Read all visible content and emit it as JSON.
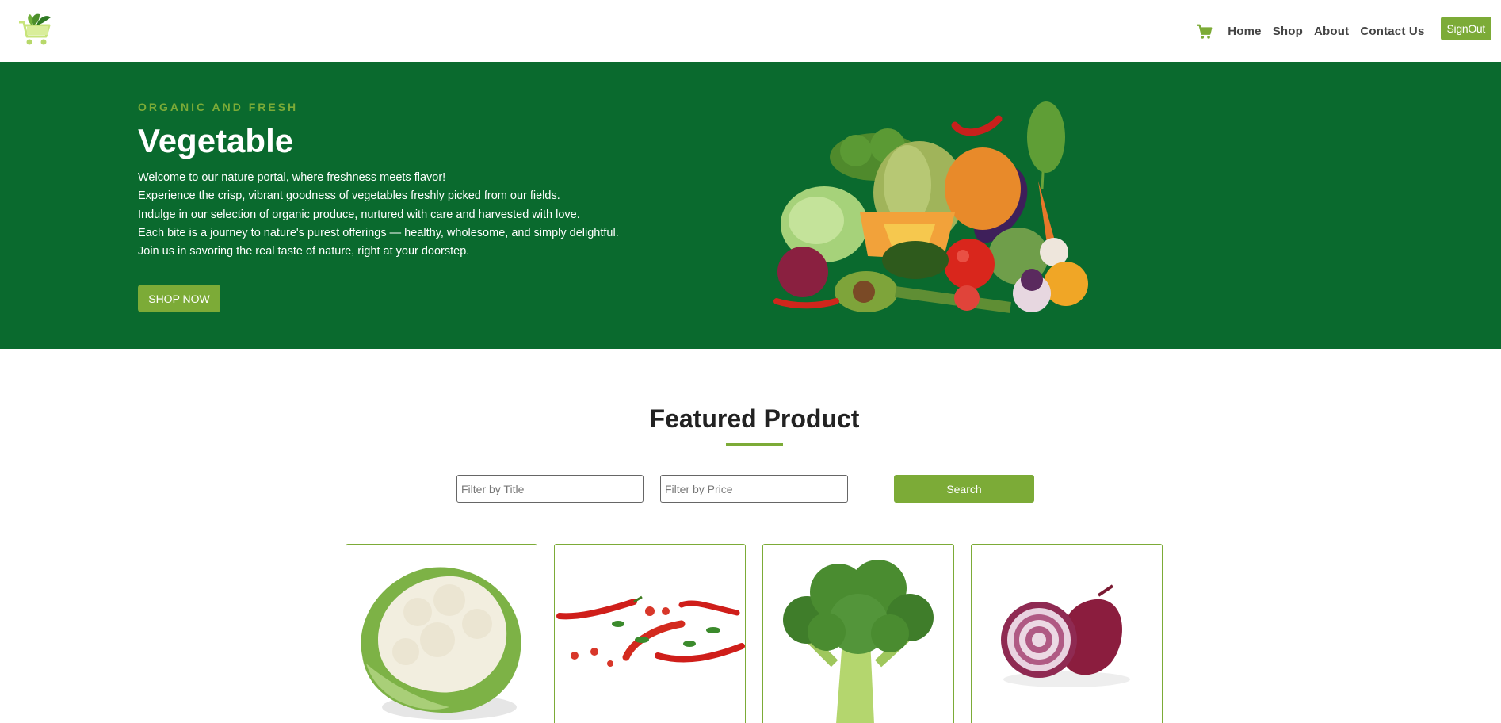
{
  "header": {
    "logo_icon": "shopping-cart-leaf-logo",
    "cart_icon": "cart-icon",
    "nav": [
      "Home",
      "Shop",
      "About",
      "Contact Us"
    ],
    "signout_label": "SignOut"
  },
  "hero": {
    "eyebrow": "ORGANIC AND FRESH",
    "title": "Vegetable",
    "lines": [
      "Welcome to our nature portal, where freshness meets flavor!",
      "Experience the crisp, vibrant goodness of vegetables freshly picked from our fields.",
      "Indulge in our selection of organic produce, nurtured with care and harvested with love.",
      "Each bite is a journey to nature's purest offerings — healthy, wholesome, and simply delightful.",
      "Join us in savoring the real taste of nature, right at your doorstep."
    ],
    "cta_label": "SHOP NOW",
    "image_icon": "vegetable-pile-image"
  },
  "featured": {
    "title": "Featured Product",
    "filter_title_placeholder": "Filter by Title",
    "filter_price_placeholder": "Filter by Price",
    "search_label": "Search",
    "products": [
      {
        "image": "cauliflower-image"
      },
      {
        "image": "red-chili-image"
      },
      {
        "image": "broccoli-image"
      },
      {
        "image": "red-onion-image"
      }
    ]
  },
  "colors": {
    "brand_green": "#7cab37",
    "hero_bg": "#0a6a2e"
  }
}
